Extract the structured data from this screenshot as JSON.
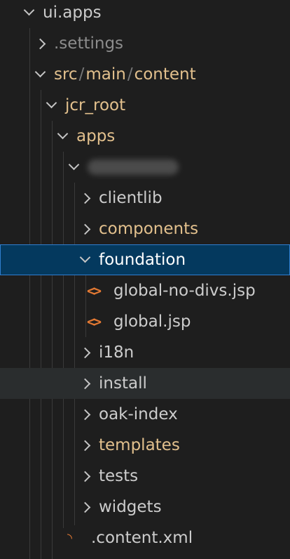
{
  "colors": {
    "background": "#1e1e1e",
    "selected_bg": "#04395e",
    "selected_border": "#2f7ecf",
    "hover_bg": "#2a2d2e",
    "text_default": "#cccccc",
    "text_modified": "#e2c08d",
    "text_muted": "#8c8c8c",
    "file_icon": "#e37933"
  },
  "tree": {
    "ui_apps": "ui.apps",
    "settings": ".settings",
    "src_path": {
      "src": "src",
      "main": "main",
      "content": "content",
      "sep": "/"
    },
    "jcr_root": "jcr_root",
    "apps": "apps",
    "redacted_folder": "",
    "clientlib": "clientlib",
    "components": "components",
    "foundation": "foundation",
    "global_no_divs": "global-no-divs.jsp",
    "global_jsp": "global.jsp",
    "i18n": "i18n",
    "install": "install",
    "oak_index": "oak-index",
    "templates": "templates",
    "tests": "tests",
    "widgets": "widgets",
    "content_xml": ".content.xml"
  },
  "icons": {
    "code_file": "code-brackets-icon",
    "xml_file": "rss-xml-icon",
    "chevron_down": "chevron-down-icon",
    "chevron_right": "chevron-right-icon"
  }
}
